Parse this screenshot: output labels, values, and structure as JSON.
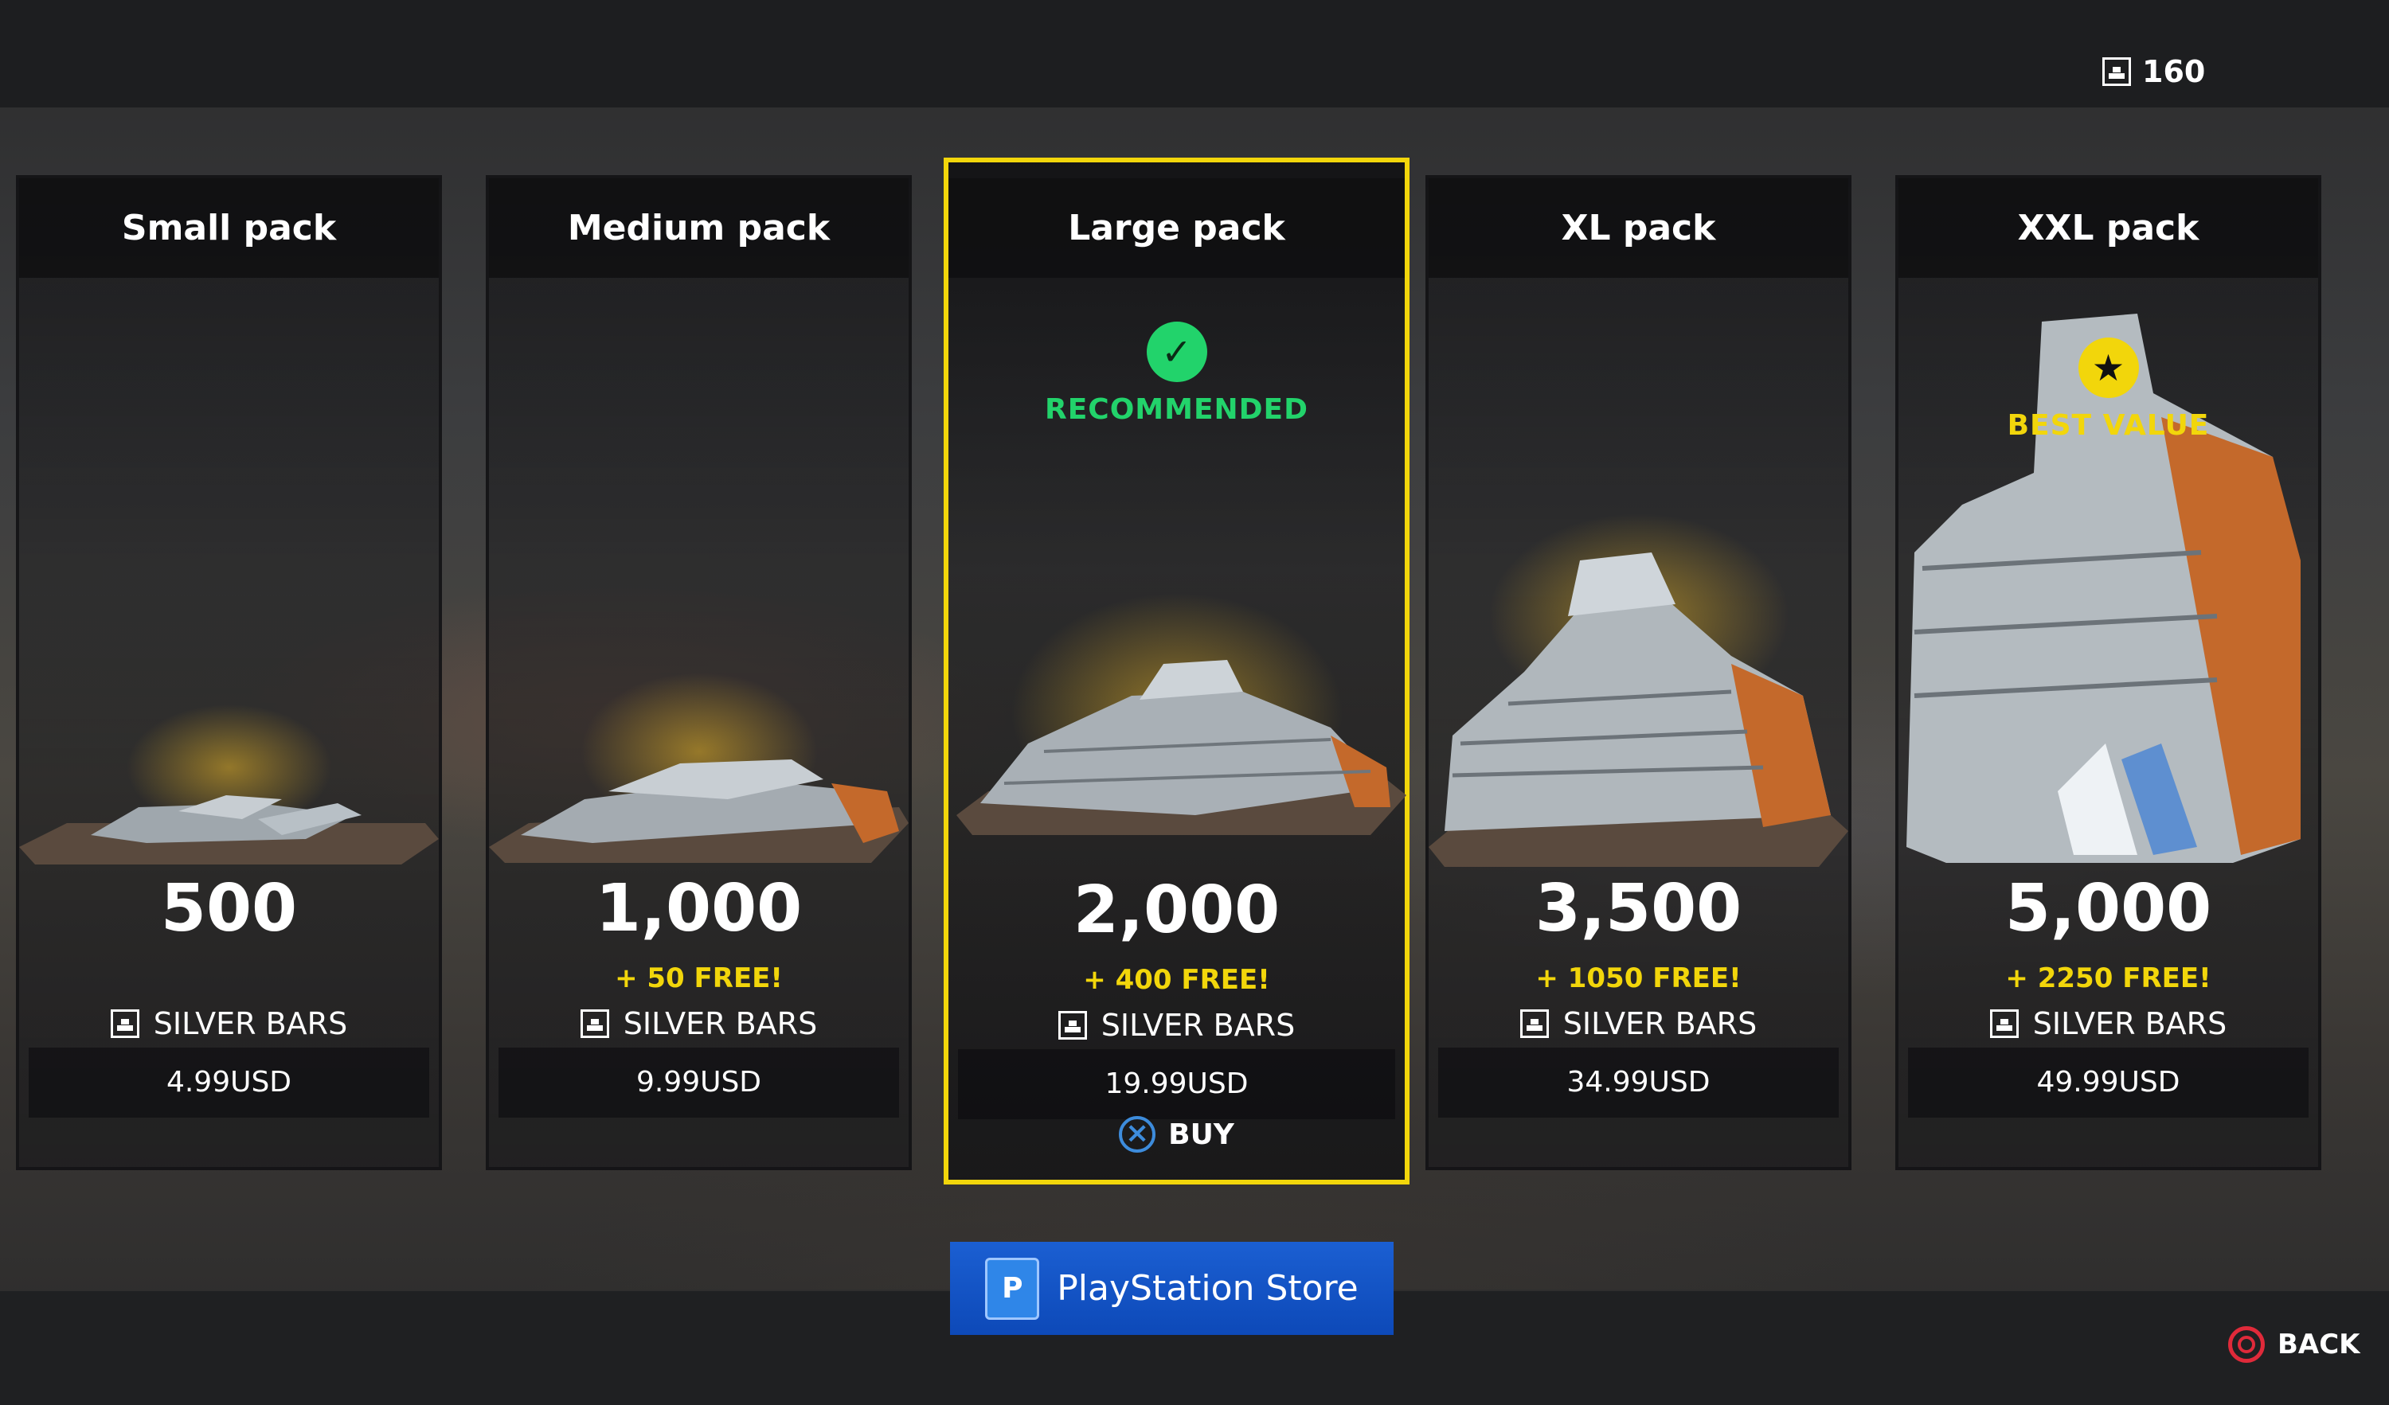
{
  "header": {
    "currency_amount": "160",
    "currency_icon": "silver-bars-icon"
  },
  "packs": [
    {
      "title": "Small pack",
      "amount": "500",
      "bonus": "",
      "unit": "SILVER BARS",
      "price": "4.99USD",
      "badge": "",
      "selected": false
    },
    {
      "title": "Medium pack",
      "amount": "1,000",
      "bonus": "+ 50 FREE!",
      "unit": "SILVER BARS",
      "price": "9.99USD",
      "badge": "",
      "selected": false
    },
    {
      "title": "Large pack",
      "amount": "2,000",
      "bonus": "+ 400 FREE!",
      "unit": "SILVER BARS",
      "price": "19.99USD",
      "badge": "RECOMMENDED",
      "selected": true,
      "buy_label": "BUY"
    },
    {
      "title": "XL pack",
      "amount": "3,500",
      "bonus": "+ 1050 FREE!",
      "unit": "SILVER BARS",
      "price": "34.99USD",
      "badge": "",
      "selected": false
    },
    {
      "title": "XXL pack",
      "amount": "5,000",
      "bonus": "+ 2250 FREE!",
      "unit": "SILVER BARS",
      "price": "49.99USD",
      "badge": "BEST VALUE",
      "selected": false
    }
  ],
  "store_button": {
    "label": "PlayStation Store"
  },
  "back_button": {
    "label": "BACK"
  },
  "colors": {
    "accent": "#f2d60b",
    "recommended": "#22d36b",
    "cross_button": "#3d8cdc",
    "circle_button": "#e02a3a",
    "store_blue": "#1b5fd2"
  }
}
